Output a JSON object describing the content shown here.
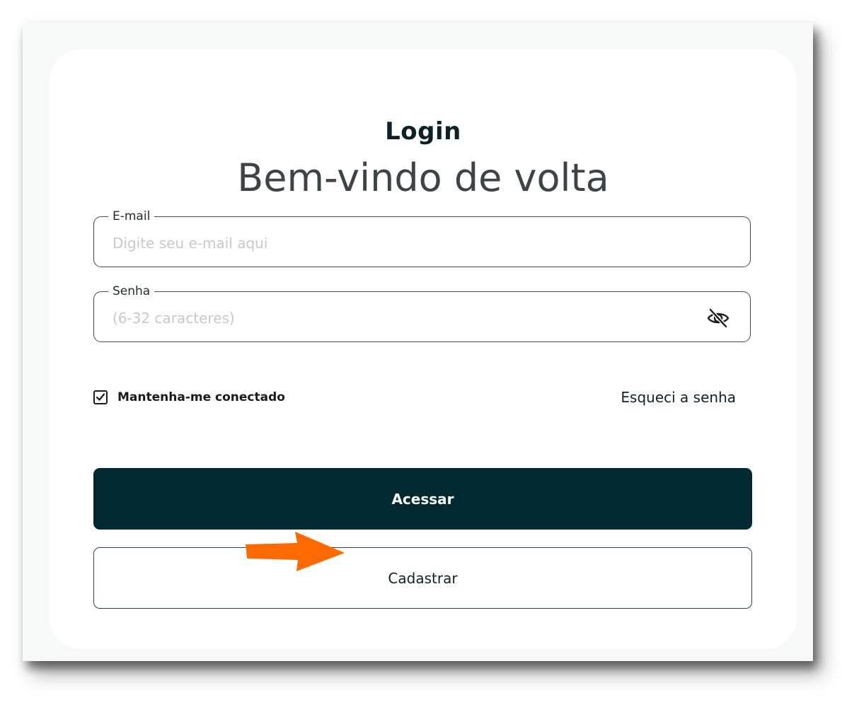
{
  "login": {
    "title": "Login",
    "subtitle": "Bem-vindo de volta",
    "email": {
      "label": "E-mail",
      "placeholder": "Digite seu e-mail aqui",
      "value": ""
    },
    "password": {
      "label": "Senha",
      "placeholder": "(6-32 caracteres)",
      "value": "",
      "toggle_icon": "eye-off-icon"
    },
    "remember": {
      "label": "Mantenha-me conectado",
      "checked": true
    },
    "forgot_label": "Esqueci a senha",
    "submit_label": "Acessar",
    "register_label": "Cadastrar"
  },
  "colors": {
    "primary": "#022831",
    "annotation_arrow": "#ff6a00",
    "placeholder": "#c5c9cb"
  }
}
